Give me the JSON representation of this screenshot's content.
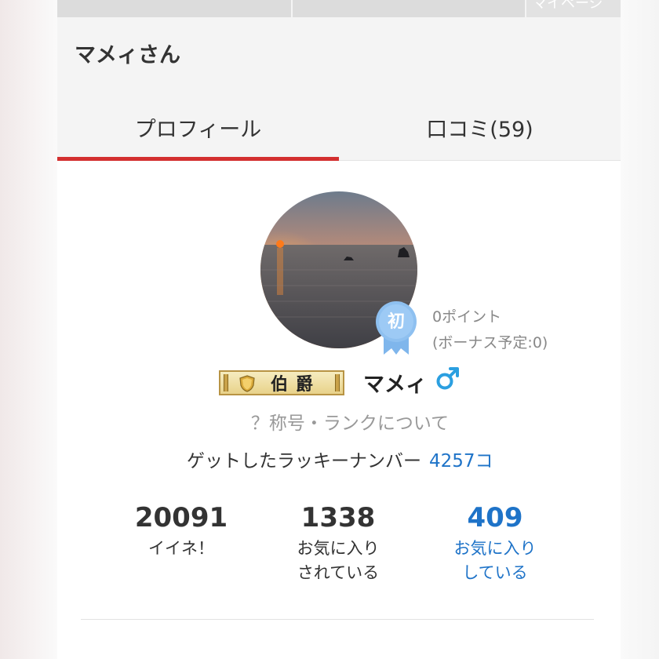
{
  "top_nav": {
    "fragment_label": "マイページ"
  },
  "header": {
    "title": "マメィさん"
  },
  "tabs": [
    {
      "label": "プロフィール",
      "active": true
    },
    {
      "label": "口コミ(59)",
      "active": false
    }
  ],
  "profile": {
    "avatar_alt": "sunset over sea",
    "badge_label": "初",
    "points_line1": "0ポイント",
    "points_line2": "(ボーナス予定:0)",
    "rank_title": "伯爵",
    "nickname": "マメィ",
    "gender_symbol": "♂",
    "rank_info_link": "？称号・ランクについて",
    "lucky_label": "ゲットしたラッキーナンバー",
    "lucky_value": "4257コ"
  },
  "stats": [
    {
      "value": "20091",
      "label_line1": "イイネ！",
      "label_line2": ""
    },
    {
      "value": "1338",
      "label_line1": "お気に入り",
      "label_line2": "されている"
    },
    {
      "value": "409",
      "label_line1": "お気に入り",
      "label_line2": "している"
    }
  ],
  "colors": {
    "accent_red": "#d32f2f",
    "link_blue": "#1e73c8",
    "badge_blue": "#8ec0f0",
    "gender_blue": "#2b9fe0"
  }
}
